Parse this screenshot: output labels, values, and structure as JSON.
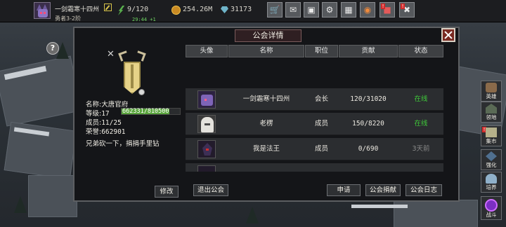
{
  "player": {
    "name": "一剑霜寒十四州",
    "rank": "勇者3-2阶",
    "stamina": "9/120",
    "stamina_timer": "29:44 +1",
    "gold": "254.26M",
    "gems": "31173"
  },
  "toolbar": {
    "icons": [
      "shop-icon",
      "mail-icon",
      "gamepad-icon",
      "gear-icon",
      "grid-icon",
      "color-wheel-icon",
      "gift-icon",
      "tools-icon"
    ],
    "alert_mark": "!"
  },
  "modal": {
    "title": "公会详情",
    "close_icon": "close-icon"
  },
  "guild": {
    "name_label": "名称:",
    "name": "大唐官府",
    "level_label": "等级:",
    "level": "17",
    "exp_text": "662331/810500",
    "exp_fraction": 0.817,
    "members_label": "成员:",
    "members": "11/25",
    "honor_label": "荣誉:",
    "honor": "662901",
    "notice": "兄弟砍一下，捐捐手里钻",
    "edit_label": "修改"
  },
  "table": {
    "headers": [
      "头像",
      "名称",
      "职位",
      "贡献",
      "状态"
    ],
    "rows": [
      {
        "name": "一剑霜寒十四州",
        "position": "会长",
        "contribution": "120/31020",
        "status": "在线",
        "status_color": "#3fc93a"
      },
      {
        "name": "老楞",
        "position": "成员",
        "contribution": "150/8220",
        "status": "在线",
        "status_color": "#3fc93a"
      },
      {
        "name": "我是法王",
        "position": "成员",
        "contribution": "0/690",
        "status": "3天前",
        "status_color": "#8a8a8a"
      }
    ]
  },
  "actions": {
    "leave": "退出公会",
    "apply": "申请",
    "donate": "公会捐献",
    "log": "公会日志"
  },
  "side_menu": [
    {
      "label": "英雄",
      "icon": "hero-icon"
    },
    {
      "label": "领地",
      "icon": "territory-icon"
    },
    {
      "label": "集市",
      "icon": "market-icon"
    },
    {
      "label": "强化",
      "icon": "enhance-icon"
    },
    {
      "label": "培养",
      "icon": "train-icon"
    },
    {
      "label": "战斗",
      "icon": "battle-portal-icon"
    }
  ],
  "help_mark": "?"
}
